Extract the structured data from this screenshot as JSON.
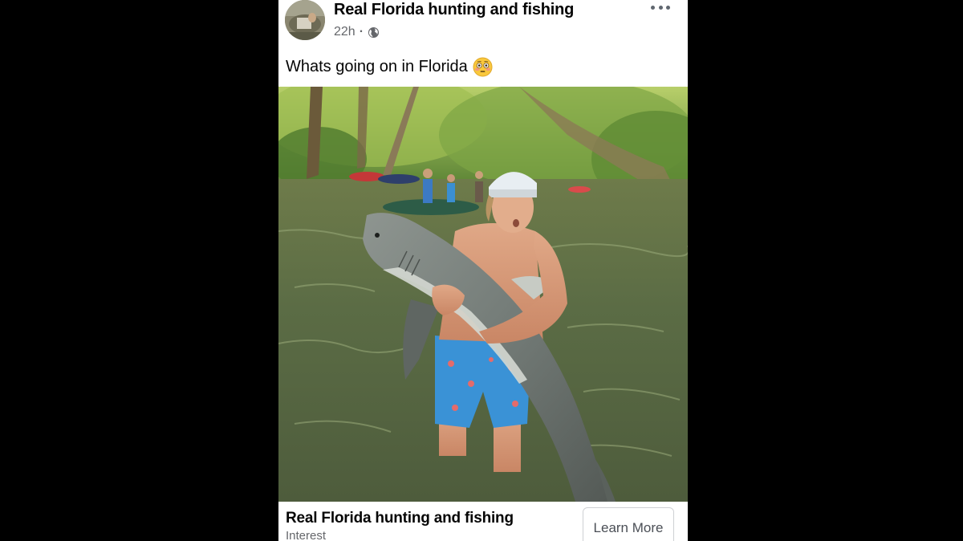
{
  "post": {
    "page_name": "Real Florida hunting and fishing",
    "time": "22h",
    "separator": "·",
    "privacy_icon": "globe-icon",
    "more_icon": "more-options-icon",
    "caption": "Whats going on in Florida",
    "caption_emoji": "flushed-face-emoji",
    "photo_subject": "photo"
  },
  "footer": {
    "title": "Real Florida hunting and fishing",
    "subtitle": "Interest",
    "cta_label": "Learn More"
  },
  "colors": {
    "background": "#000000",
    "card": "#ffffff",
    "text_primary": "#050505",
    "text_secondary": "#65676b",
    "button_border": "#ced0d4"
  }
}
